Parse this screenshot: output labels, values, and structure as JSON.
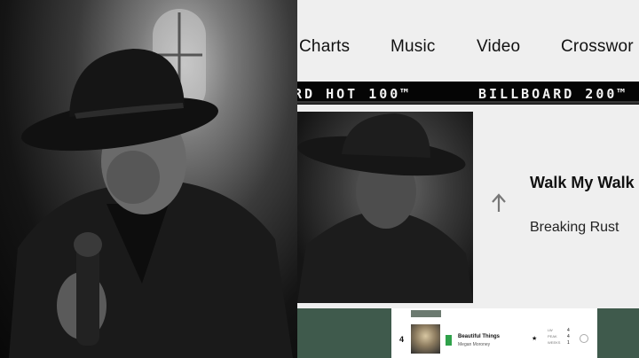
{
  "nav": {
    "items": [
      "Charts",
      "Music",
      "Video",
      "Crosswor"
    ]
  },
  "ticker": {
    "items": [
      "RD HOT 100™",
      "BILLBOARD 200™"
    ]
  },
  "featured": {
    "title": "Walk My Walk",
    "artist": "Breaking Rust",
    "trend_icon": "arrow-up-icon"
  },
  "chart_list": {
    "row": {
      "rank": "4",
      "title": "Beautiful Things",
      "artist": "Megan Moroney",
      "stats": [
        {
          "label": "LW",
          "value": "4"
        },
        {
          "label": "PEAK",
          "value": "4"
        },
        {
          "label": "WEEKS",
          "value": "1"
        }
      ]
    }
  },
  "colors": {
    "ticker_bg": "#050505",
    "green_strip": "#3f5a4c",
    "badge_green": "#2fa14a"
  }
}
